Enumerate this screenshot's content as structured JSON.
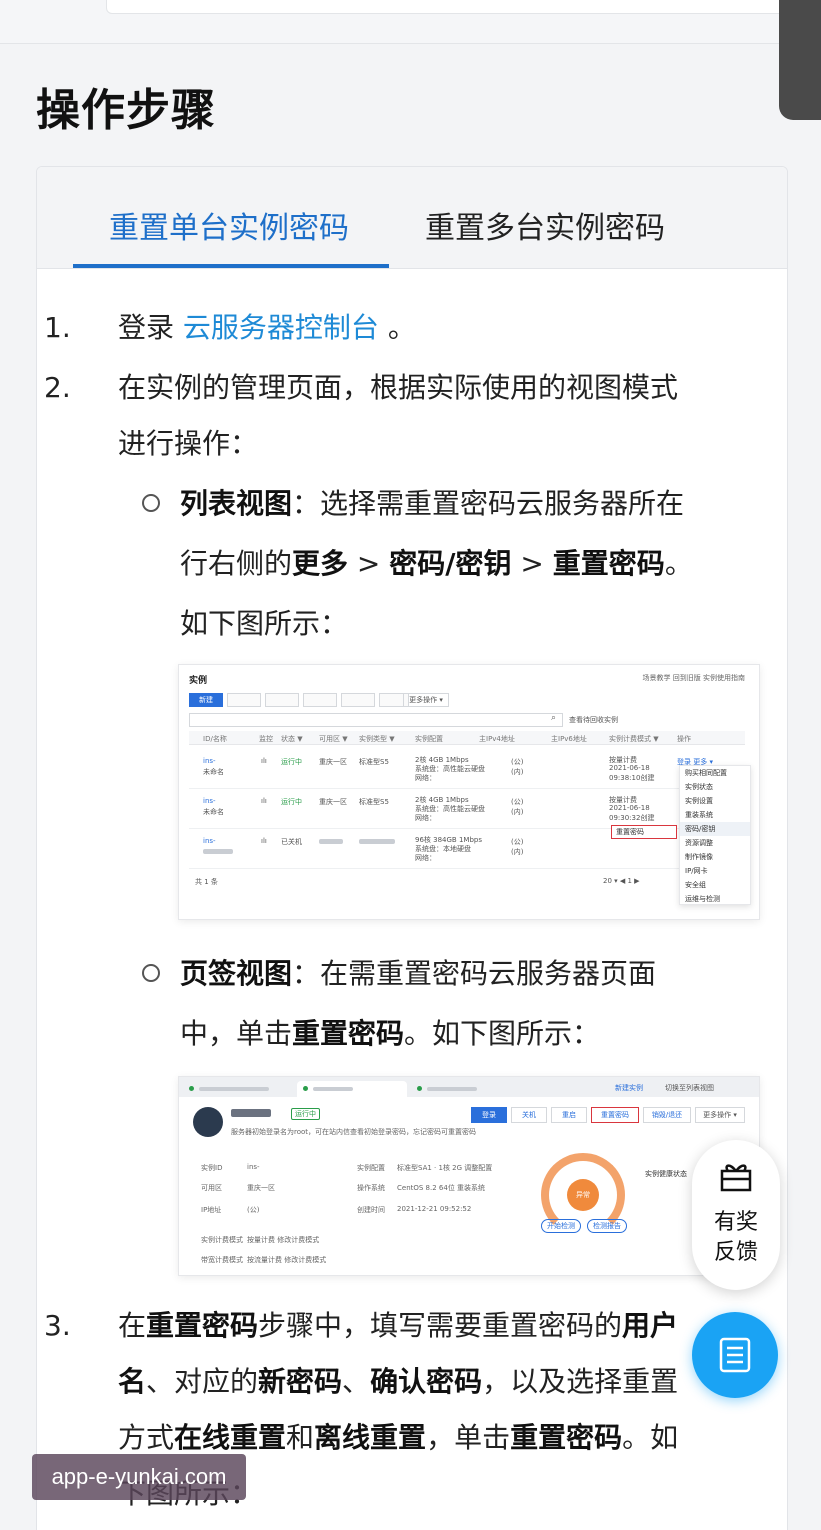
{
  "page": {
    "title": "操作步骤"
  },
  "tabs": [
    {
      "label": "重置单台实例密码",
      "active": true
    },
    {
      "label": "重置多台实例密码",
      "active": false
    }
  ],
  "steps": {
    "s1": {
      "num": "1.",
      "pre": "登录 ",
      "link": "云服务器控制台",
      "post": " 。"
    },
    "s2": {
      "num": "2.",
      "line1": "在实例的管理页面，根据实际使用的视图模式",
      "line2": "进行操作："
    },
    "s3": {
      "num": "3.",
      "a": "在",
      "b1": "重置密码",
      "c": "步骤中，填写需要重置密码的",
      "b2": "用户",
      "b2b": "名",
      "d": "、对应的",
      "b3": "新密码",
      "e": "、",
      "b4": "确认密码",
      "f": "，以及选择重置",
      "g": "方式",
      "b5": "在线重置",
      "h": "和",
      "b6": "离线重置",
      "i": "，单击",
      "b7": "重置密码",
      "j": "。如",
      "k": "下图所示："
    }
  },
  "bullets": {
    "list": {
      "title": "列表视图",
      "t1": "：选择需重置密码云服务器所在",
      "t2a": "行右侧的",
      "b1": "更多",
      "sep1": " > ",
      "b2": "密码/密钥",
      "sep2": " > ",
      "b3": "重置密码",
      "t2b": "。",
      "t3": "如下图所示："
    },
    "tab": {
      "title": "页签视图",
      "t1": "：在需重置密码云服务器页面",
      "t2a": "中，单击",
      "b1": "重置密码",
      "t2b": "。如下图所示："
    }
  },
  "shot1": {
    "title": "实例",
    "right": "场景教学  回到旧版  实例使用指南",
    "new_btn": "新建",
    "more_ops": "更多操作 ▾",
    "view_link": "查看待回收实例",
    "headers": [
      "ID/名称",
      "监控",
      "状态 ▼",
      "可用区 ▼",
      "实例类型 ▼",
      "实例配置",
      "主IPv4地址",
      "主IPv6地址",
      "实例计费模式 ▼",
      "操作"
    ],
    "rows": [
      {
        "id": "ins-",
        "sub": "未命名",
        "status": "运行中",
        "zone": "重庆一区",
        "type": "标准型S5",
        "cfg": "2核 4GB 1Mbps",
        "cfg2": "系统盘：高性能云硬盘",
        "cfg3": "网络：",
        "ip": "(公)",
        "ip2": "(内)",
        "billing": "按量计费",
        "date": "2021-06-18",
        "time": "09:38:10创建",
        "ops": "登录  更多 ▾"
      },
      {
        "id": "ins-",
        "sub": "未命名",
        "status": "运行中",
        "zone": "重庆一区",
        "type": "标准型S5",
        "cfg": "2核 4GB 1Mbps",
        "cfg2": "系统盘：高性能云硬盘",
        "cfg3": "网络：",
        "ip": "(公)",
        "ip2": "(内)",
        "billing": "按量计费",
        "date": "2021-06-18",
        "time": "09:30:32创建",
        "ops": ""
      },
      {
        "id": "ins-",
        "sub": "",
        "status": "已关机",
        "zone": "",
        "type": "",
        "cfg": "96核 384GB 1Mbps",
        "cfg2": "系统盘：本地硬盘",
        "cfg3": "网络：",
        "ip": "(公)",
        "ip2": "(内)",
        "billing": "",
        "date": "",
        "time": "",
        "ops": ""
      }
    ],
    "total": "共 1 条",
    "pager": "20 ▾   ◀  1  ▶",
    "menu": [
      "购买相同配置",
      "实例状态",
      "实例设置",
      "重装系统",
      "密码/密钥",
      "资源调整",
      "制作镜像",
      "IP/网卡",
      "安全组",
      "运维与检测"
    ],
    "submenu": "重置密码"
  },
  "shot2": {
    "new_instance": "新建实例",
    "switch": "切换至列表视图",
    "status": "运行中",
    "notice": "服务器初始登录名为root，可在站内信查看初始登录密码，忘记密码可重置密码",
    "btns": [
      "登录",
      "关机",
      "重启",
      "重置密码",
      "销毁/退还",
      "更多操作 ▾"
    ],
    "info_labels": [
      "实例ID",
      "可用区",
      "IP地址",
      "实例计费模式",
      "带宽计费模式"
    ],
    "info_values": [
      "ins-",
      "重庆一区",
      "(公)",
      "按量计费  修改计费模式",
      "按流量计费  修改计费模式"
    ],
    "info_labels2": [
      "实例配置",
      "操作系统",
      "创建时间"
    ],
    "info_values2": [
      "标准型SA1 · 1核 2G  调整配置",
      "CentOS 8.2 64位  重装系统",
      "2021-12-21 09:52:52"
    ],
    "gauge_label": "异常",
    "health_title": "实例健康状态",
    "small_btns": [
      "开始检测",
      "检测报告"
    ]
  },
  "feedback": {
    "line1": "有奖",
    "line2": "反馈"
  },
  "watermark": "app-e-yunkai.com",
  "colors": {
    "accent": "#1e6fc9",
    "link": "#1e8ad6",
    "fab": "#1aa3f4"
  }
}
